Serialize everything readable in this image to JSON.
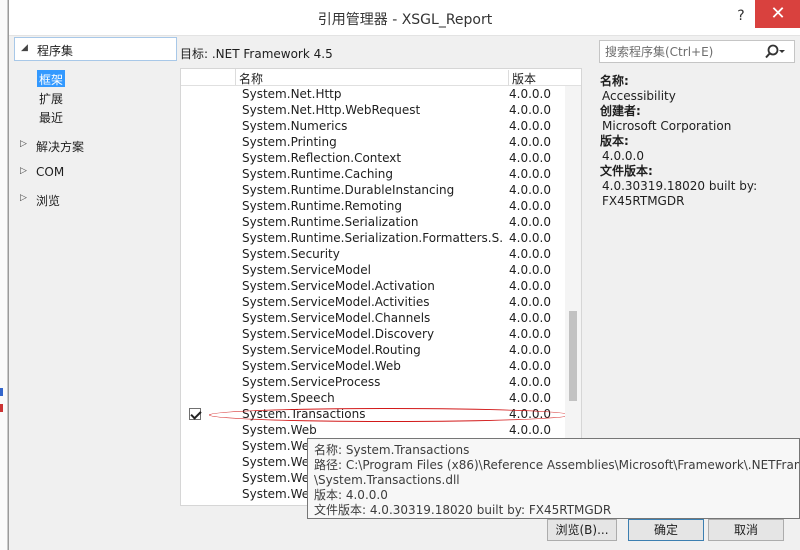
{
  "window": {
    "title": "引用管理器 - XSGL_Report",
    "help_glyph": "?",
    "close_glyph": "✕"
  },
  "nav": {
    "assemblies": "程序集",
    "framework": "框架",
    "extensions": "扩展",
    "recent": "最近",
    "solution": "解决方案",
    "com": "COM",
    "browse": "浏览"
  },
  "target": "目标: .NET Framework 4.5",
  "search": {
    "placeholder": "搜索程序集(Ctrl+E)"
  },
  "list": {
    "col_name": "名称",
    "col_version": "版本",
    "rows": [
      {
        "name": "System.Net.Http",
        "version": "4.0.0.0",
        "checked": false
      },
      {
        "name": "System.Net.Http.WebRequest",
        "version": "4.0.0.0",
        "checked": false
      },
      {
        "name": "System.Numerics",
        "version": "4.0.0.0",
        "checked": false
      },
      {
        "name": "System.Printing",
        "version": "4.0.0.0",
        "checked": false
      },
      {
        "name": "System.Reflection.Context",
        "version": "4.0.0.0",
        "checked": false
      },
      {
        "name": "System.Runtime.Caching",
        "version": "4.0.0.0",
        "checked": false
      },
      {
        "name": "System.Runtime.DurableInstancing",
        "version": "4.0.0.0",
        "checked": false
      },
      {
        "name": "System.Runtime.Remoting",
        "version": "4.0.0.0",
        "checked": false
      },
      {
        "name": "System.Runtime.Serialization",
        "version": "4.0.0.0",
        "checked": false
      },
      {
        "name": "System.Runtime.Serialization.Formatters.S...",
        "version": "4.0.0.0",
        "checked": false
      },
      {
        "name": "System.Security",
        "version": "4.0.0.0",
        "checked": false
      },
      {
        "name": "System.ServiceModel",
        "version": "4.0.0.0",
        "checked": false
      },
      {
        "name": "System.ServiceModel.Activation",
        "version": "4.0.0.0",
        "checked": false
      },
      {
        "name": "System.ServiceModel.Activities",
        "version": "4.0.0.0",
        "checked": false
      },
      {
        "name": "System.ServiceModel.Channels",
        "version": "4.0.0.0",
        "checked": false
      },
      {
        "name": "System.ServiceModel.Discovery",
        "version": "4.0.0.0",
        "checked": false
      },
      {
        "name": "System.ServiceModel.Routing",
        "version": "4.0.0.0",
        "checked": false
      },
      {
        "name": "System.ServiceModel.Web",
        "version": "4.0.0.0",
        "checked": false
      },
      {
        "name": "System.ServiceProcess",
        "version": "4.0.0.0",
        "checked": false
      },
      {
        "name": "System.Speech",
        "version": "4.0.0.0",
        "checked": false
      },
      {
        "name": "System.Transactions",
        "version": "4.0.0.0",
        "checked": true
      },
      {
        "name": "System.Web",
        "version": "4.0.0.0",
        "checked": false
      },
      {
        "name": "System.Web.",
        "version": "",
        "checked": false
      },
      {
        "name": "System.Web.",
        "version": "",
        "checked": false
      },
      {
        "name": "System.Web.",
        "version": "",
        "checked": false
      },
      {
        "name": "System.Web.",
        "version": "",
        "checked": false
      }
    ]
  },
  "details": {
    "name_label": "名称:",
    "name_value": "Accessibility",
    "creator_label": "创建者:",
    "creator_value": "Microsoft Corporation",
    "version_label": "版本:",
    "version_value": "4.0.0.0",
    "file_version_label": "文件版本:",
    "file_version_value_1": "4.0.30319.18020 built by:",
    "file_version_value_2": "FX45RTMGDR"
  },
  "tooltip": {
    "line1": "名称: System.Transactions",
    "line2": "路径: C:\\Program Files (x86)\\Reference Assemblies\\Microsoft\\Framework\\.NETFram",
    "line3": "\\System.Transactions.dll",
    "line4": "版本: 4.0.0.0",
    "line5": "文件版本: 4.0.30319.18020 built by: FX45RTMGDR"
  },
  "buttons": {
    "browse": "浏览(B)...",
    "ok": "确定",
    "cancel": "取消"
  }
}
